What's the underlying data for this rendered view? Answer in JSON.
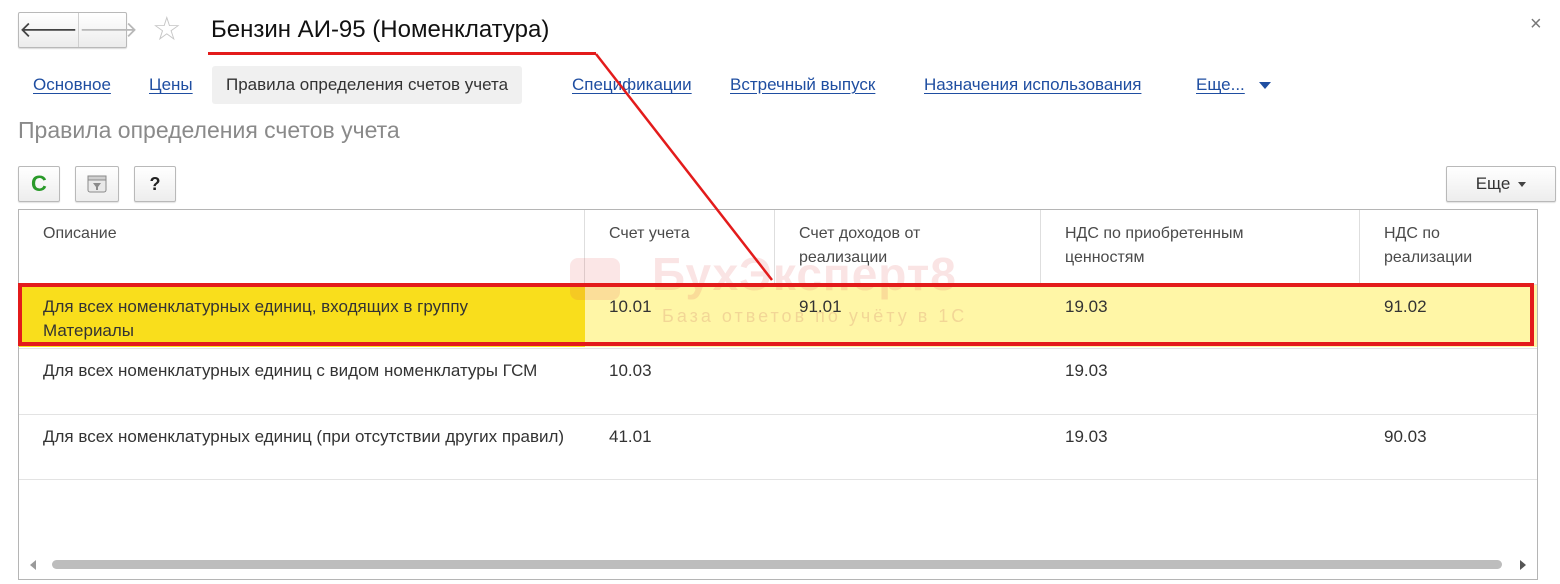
{
  "window": {
    "title": "Бензин АИ-95 (Номенклатура)",
    "close_glyph": "×",
    "back_glyph": "🡐",
    "forward_glyph": "🡒",
    "favorite_glyph": "☆"
  },
  "tabs": [
    {
      "label": "Основное"
    },
    {
      "label": "Цены"
    },
    {
      "label": "Правила определения счетов учета",
      "active": true
    },
    {
      "label": "Спецификации"
    },
    {
      "label": "Встречный выпуск"
    },
    {
      "label": "Назначения использования"
    },
    {
      "label": "Еще..."
    }
  ],
  "section": {
    "title": "Правила определения счетов учета"
  },
  "toolbar": {
    "refresh_glyph": "C",
    "help_label": "?",
    "more_label": "Еще"
  },
  "table": {
    "columns": [
      "Описание",
      "Счет учета",
      "Счет доходов от реализации",
      "НДС по приобретенным ценностям",
      "НДС по реализации"
    ],
    "rows": [
      {
        "description": "Для всех номенклатурных единиц, входящих в группу Материалы",
        "account": "10.01",
        "income_account": "91.01",
        "vat_purchase": "19.03",
        "vat_sale": "91.02",
        "selected": true
      },
      {
        "description": "Для всех номенклатурных единиц с видом номенклатуры ГСМ",
        "account": "10.03",
        "income_account": "",
        "vat_purchase": "19.03",
        "vat_sale": ""
      },
      {
        "description": "Для всех номенклатурных единиц (при отсутствии других правил)",
        "account": "41.01",
        "income_account": "",
        "vat_purchase": "19.03",
        "vat_sale": "90.03"
      }
    ]
  },
  "watermark": {
    "brand": "БухЭксперт8",
    "tagline": "База ответов по учёту в 1С"
  },
  "colors": {
    "link": "#1f4ea1",
    "selected_row": "#fff6a6",
    "selected_cell": "#f9de1c",
    "annotation": "#e31b1b"
  }
}
